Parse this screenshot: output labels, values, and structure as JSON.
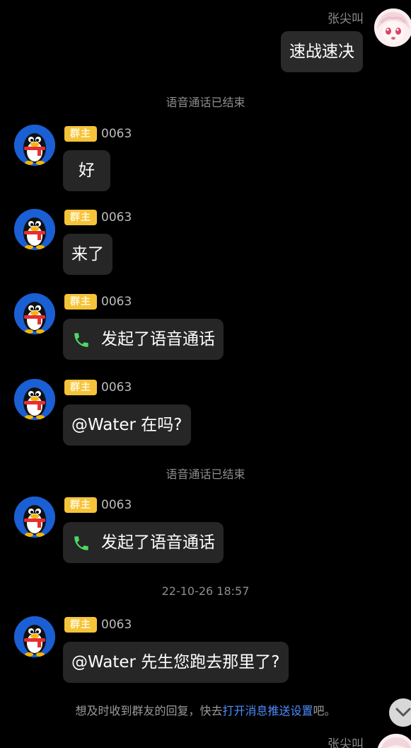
{
  "top_message": {
    "sender": "张尖叫",
    "text": "速战速决"
  },
  "system_messages": {
    "call_ended_1": "语音通话已结束",
    "call_ended_2": "语音通话已结束",
    "timestamp": "22-10-26 18:57"
  },
  "group_badge": "群主",
  "messages": [
    {
      "nick": "0063",
      "text": "好"
    },
    {
      "nick": "0063",
      "text": "来了"
    },
    {
      "nick": "0063",
      "text": "发起了语音通话"
    },
    {
      "nick": "0063",
      "text": "@Water 在吗?"
    },
    {
      "nick": "0063",
      "text": "发起了语音通话"
    },
    {
      "nick": "0063",
      "text": "@Water 先生您跑去那里了?"
    }
  ],
  "notification_tip": {
    "prefix": "想及时收到群友的回复，快去",
    "link": "打开消息推送设置",
    "suffix": "吧。"
  },
  "bottom_partial_sender": "张尖叫",
  "icons": {
    "phone": "phone-icon",
    "scroll_down": "chevron-down-icon"
  },
  "colors": {
    "background": "#000000",
    "bubble": "#262626",
    "badge": "#f5c33a",
    "link": "#4c8dff",
    "phone_green": "#4cd964"
  }
}
